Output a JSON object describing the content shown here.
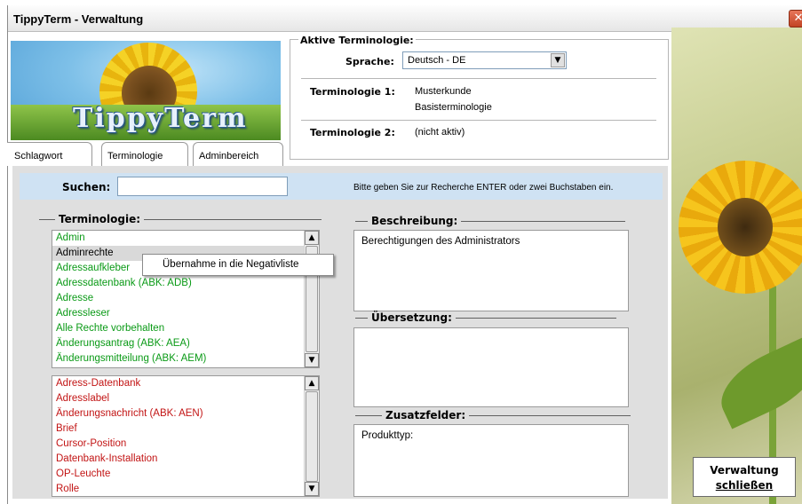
{
  "window": {
    "title": "TippyTerm - Verwaltung",
    "close_glyph": "✕"
  },
  "logo": {
    "text": "TippyTerm"
  },
  "tabs": [
    {
      "label": "Schlagwort"
    },
    {
      "label": "Terminologie"
    },
    {
      "label": "Adminbereich"
    }
  ],
  "active_terminology": {
    "legend": "Aktive Terminologie:",
    "language_label": "Sprache:",
    "language_value": "Deutsch - DE",
    "term1_label": "Terminologie 1:",
    "term1_line1": "Musterkunde",
    "term1_line2": "Basisterminologie",
    "term2_label": "Terminologie 2:",
    "term2_value": "(nicht aktiv)"
  },
  "search": {
    "label": "Suchen:",
    "value": "",
    "hint": "Bitte geben Sie zur Recherche ENTER oder zwei Buchstaben ein."
  },
  "terminology_group": {
    "title": "Terminologie:"
  },
  "green_list": [
    "Admin",
    "Adminrechte",
    "Adressaufkleber",
    "Adressdatenbank (ABK: ADB)",
    "Adresse",
    "Adressleser",
    "Alle Rechte vorbehalten",
    "Änderungsantrag (ABK: AEA)",
    "Änderungsmitteilung (ABK: AEM)"
  ],
  "red_list": [
    "Adress-Datenbank",
    "Adresslabel",
    "Änderungsnachricht (ABK: AEN)",
    "Brief",
    "Cursor-Position",
    "Datenbank-Installation",
    "OP-Leuchte",
    "Rolle"
  ],
  "context_menu": {
    "item": "Übernahme in die Negativliste"
  },
  "description": {
    "title": "Beschreibung:",
    "text": "Berechtigungen des Administrators"
  },
  "translation": {
    "title": "Übersetzung:",
    "text": ""
  },
  "extra_fields": {
    "title": "Zusatzfelder:",
    "text": "Produkttyp:"
  },
  "close_button": {
    "line1": "Verwaltung",
    "line2": "schließen"
  },
  "icons": {
    "scroll_up": "▲",
    "scroll_down": "▼",
    "dropdown": "▼"
  },
  "colors": {
    "search_bar": "#cfe2f3",
    "panel": "#dfdfdf",
    "allowed_term": "#0a9a16",
    "blocked_term": "#c21414"
  }
}
